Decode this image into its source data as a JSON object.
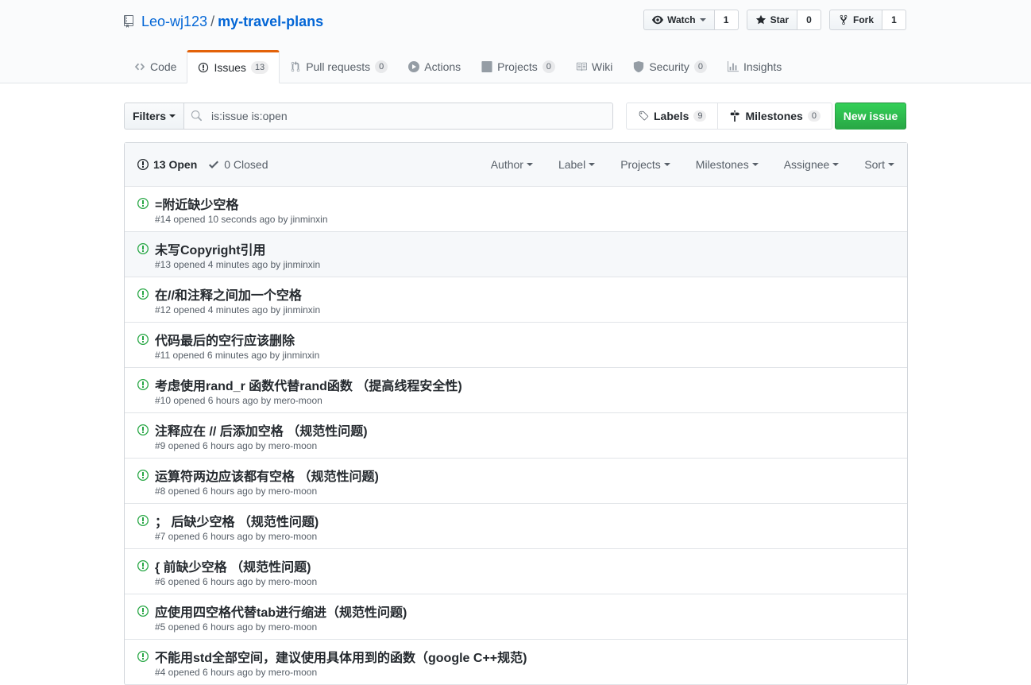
{
  "repo": {
    "owner": "Leo-wj123",
    "separator": "/",
    "name": "my-travel-plans"
  },
  "actions": {
    "watch_label": "Watch",
    "watch_count": "1",
    "star_label": "Star",
    "star_count": "0",
    "fork_label": "Fork",
    "fork_count": "1"
  },
  "tabs": [
    {
      "label": "Code",
      "badge": null
    },
    {
      "label": "Issues",
      "badge": "13"
    },
    {
      "label": "Pull requests",
      "badge": "0"
    },
    {
      "label": "Actions",
      "badge": null
    },
    {
      "label": "Projects",
      "badge": "0"
    },
    {
      "label": "Wiki",
      "badge": null
    },
    {
      "label": "Security",
      "badge": "0"
    },
    {
      "label": "Insights",
      "badge": null
    }
  ],
  "subnav": {
    "filters_label": "Filters",
    "search_value": "is:issue is:open",
    "labels_label": "Labels",
    "labels_count": "9",
    "milestones_label": "Milestones",
    "milestones_count": "0",
    "new_issue_label": "New issue"
  },
  "list_header": {
    "open_label": "13 Open",
    "closed_label": "0 Closed",
    "filters": [
      "Author",
      "Label",
      "Projects",
      "Milestones",
      "Assignee",
      "Sort"
    ]
  },
  "issues": [
    {
      "title": "=附近缺少空格",
      "meta": "#14 opened 10 seconds ago by jinminxin"
    },
    {
      "title": "未写Copyright引用",
      "meta": "#13 opened 4 minutes ago by jinminxin"
    },
    {
      "title": "在//和注释之间加一个空格",
      "meta": "#12 opened 4 minutes ago by jinminxin"
    },
    {
      "title": "代码最后的空行应该删除",
      "meta": "#11 opened 6 minutes ago by jinminxin"
    },
    {
      "title": "考虑使用rand_r 函数代替rand函数 （提高线程安全性)",
      "meta": "#10 opened 6 hours ago by mero-moon"
    },
    {
      "title": "注释应在 // 后添加空格 （规范性问题)",
      "meta": "#9 opened 6 hours ago by mero-moon"
    },
    {
      "title": "运算符两边应该都有空格 （规范性问题)",
      "meta": "#8 opened 6 hours ago by mero-moon"
    },
    {
      "title": "； 后缺少空格 （规范性问题)",
      "meta": "#7 opened 6 hours ago by mero-moon"
    },
    {
      "title": "{ 前缺少空格 （规范性问题)",
      "meta": "#6 opened 6 hours ago by mero-moon"
    },
    {
      "title": "应使用四空格代替tab进行缩进（规范性问题)",
      "meta": "#5 opened 6 hours ago by mero-moon"
    },
    {
      "title": "不能用std全部空间，建议使用具体用到的函数（google C++规范)",
      "meta": "#4 opened 6 hours ago by mero-moon"
    }
  ],
  "colors": {
    "accent": "#0366d6",
    "open_green": "#28a745",
    "tab_orange": "#e36209",
    "text_muted": "#586069"
  }
}
